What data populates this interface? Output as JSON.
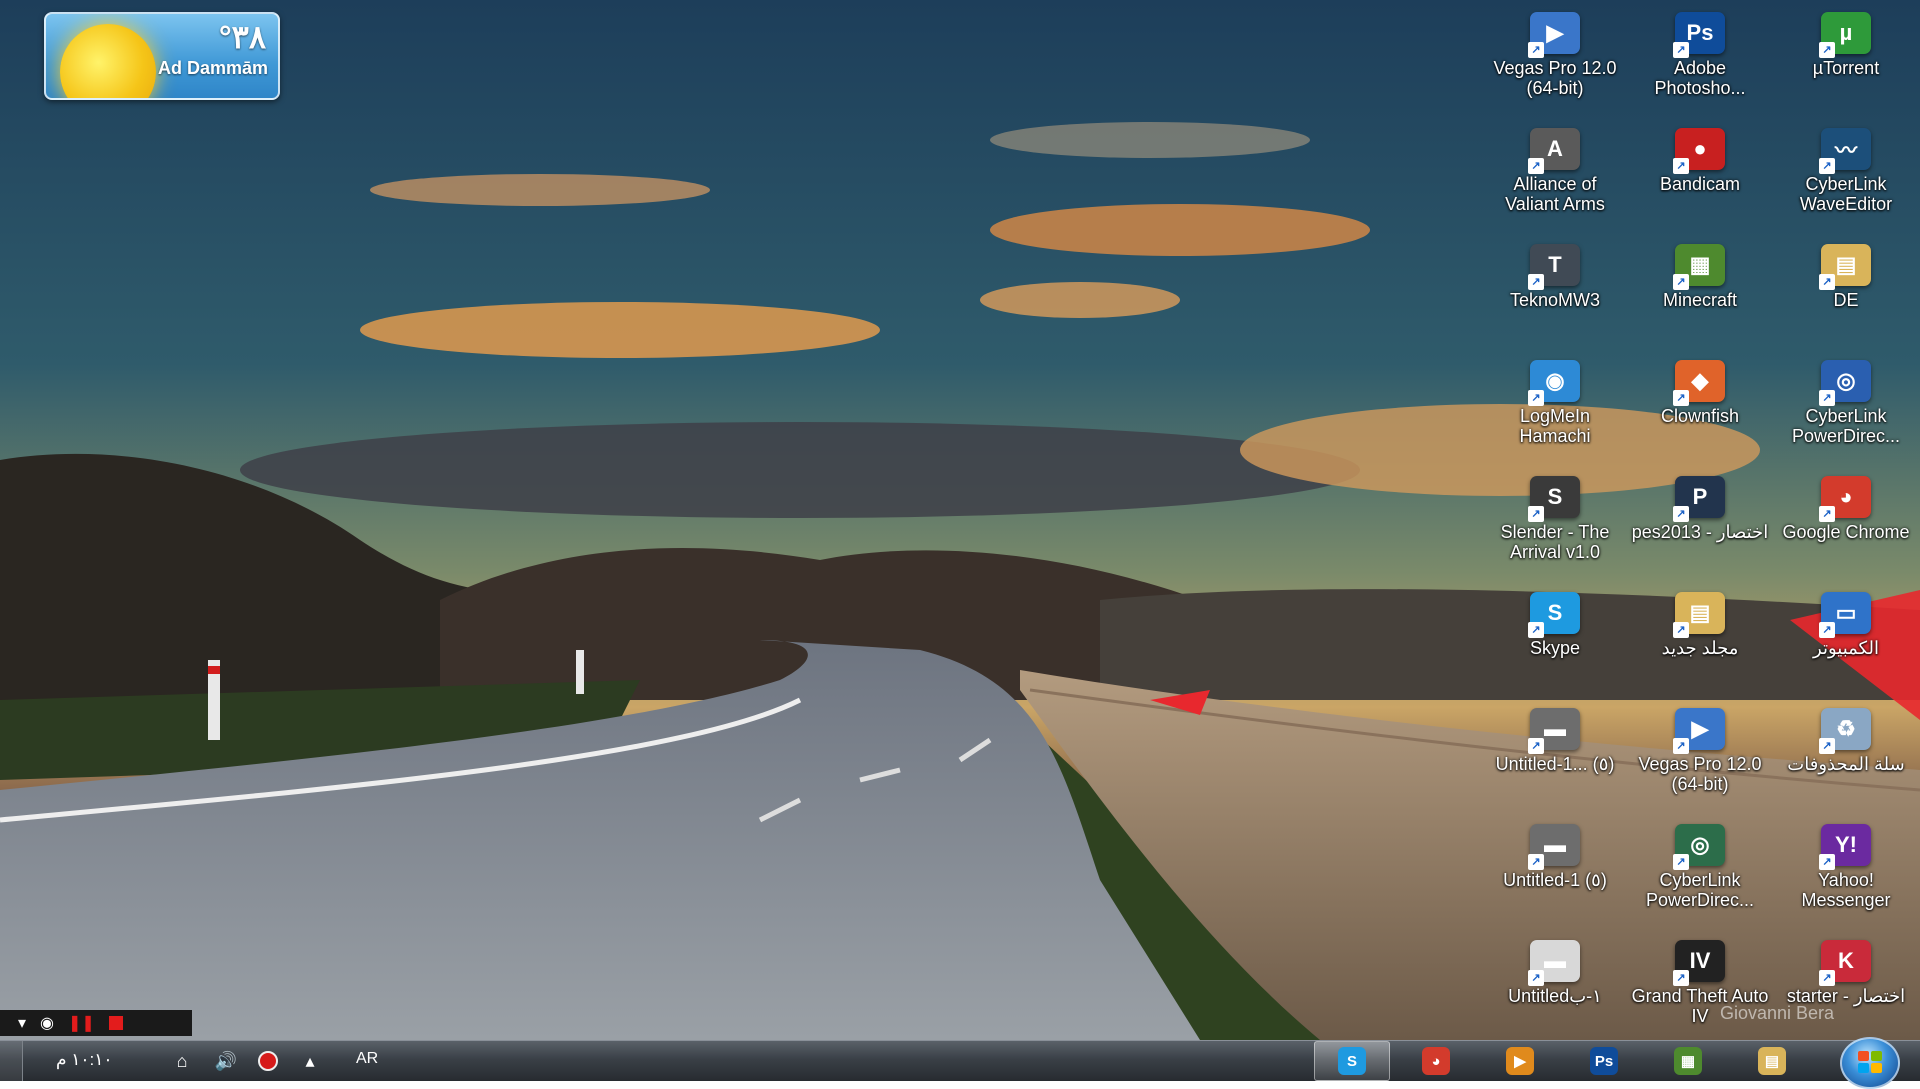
{
  "weather": {
    "temperature": "°٣٨",
    "city": "Ad Dammām"
  },
  "icons": [
    {
      "label": "Vegas Pro 12.0 (64-bit)",
      "icon": "vegas-icon",
      "color": "#3a76c9",
      "symbol": "▶"
    },
    {
      "label": "Adobe Photosho...",
      "icon": "photoshop-icon",
      "color": "#0f4c9a",
      "symbol": "Ps"
    },
    {
      "label": "µTorrent",
      "icon": "utorrent-icon",
      "color": "#2e9a3a",
      "symbol": "µ"
    },
    {
      "label": "Alliance of Valiant Arms",
      "icon": "ava-icon",
      "color": "#5a5a5a",
      "symbol": "A"
    },
    {
      "label": "Bandicam",
      "icon": "bandicam-icon",
      "color": "#c82020",
      "symbol": "●"
    },
    {
      "label": "CyberLink WaveEditor",
      "icon": "waveeditor-icon",
      "color": "#1c4f7a",
      "symbol": "〰"
    },
    {
      "label": "TeknoMW3",
      "icon": "teknomw3-icon",
      "color": "#404a55",
      "symbol": "T"
    },
    {
      "label": "Minecraft",
      "icon": "minecraft-icon",
      "color": "#4e8a2e",
      "symbol": "▦"
    },
    {
      "label": "DE",
      "icon": "folder-icon",
      "color": "#d9b45a",
      "symbol": "▤"
    },
    {
      "label": "LogMeIn Hamachi",
      "icon": "hamachi-icon",
      "color": "#2d8ad6",
      "symbol": "◉"
    },
    {
      "label": "Clownfish",
      "icon": "clownfish-icon",
      "color": "#e0632a",
      "symbol": "◆"
    },
    {
      "label": "CyberLink PowerDirec...",
      "icon": "powerdirector-icon",
      "color": "#2a5fb0",
      "symbol": "◎"
    },
    {
      "label": "Slender - The Arrival v1.0",
      "icon": "slender-icon",
      "color": "#3a3a3a",
      "symbol": "S"
    },
    {
      "label": "pes2013 - اختصار",
      "icon": "pes2013-icon",
      "color": "#22344d",
      "symbol": "P"
    },
    {
      "label": "Google Chrome",
      "icon": "chrome-icon",
      "color": "#d33b2c",
      "symbol": "◕"
    },
    {
      "label": "Skype",
      "icon": "skype-icon",
      "color": "#1e9ae0",
      "symbol": "S"
    },
    {
      "label": "مجلد جديد",
      "icon": "new-folder-icon",
      "color": "#d9b45a",
      "symbol": "▤"
    },
    {
      "label": "الكمبيوتر",
      "icon": "computer-icon",
      "color": "#2f73c9",
      "symbol": "▭"
    },
    {
      "label": "Untitled-1... (٥)",
      "icon": "untitled-file-icon",
      "color": "#6d6d6d",
      "symbol": "▬"
    },
    {
      "label": "Vegas Pro 12.0 (64-bit)",
      "icon": "vegas-icon",
      "color": "#3a76c9",
      "symbol": "▶"
    },
    {
      "label": "سلة المحذوفات",
      "icon": "recycle-bin-icon",
      "color": "#8aa7c4",
      "symbol": "♻"
    },
    {
      "label": "Untitled-1 (٥)",
      "icon": "untitled-file-icon",
      "color": "#6d6d6d",
      "symbol": "▬"
    },
    {
      "label": "CyberLink PowerDirec...",
      "icon": "powerdirector-icon",
      "color": "#2c6d4a",
      "symbol": "◎"
    },
    {
      "label": "Yahoo! Messenger",
      "icon": "yahoo-messenger-icon",
      "color": "#6b2aa0",
      "symbol": "Y!"
    },
    {
      "label": "Untitled١-ب",
      "icon": "untitled-file-icon",
      "color": "#d8d8d8",
      "symbol": "▬"
    },
    {
      "label": "Grand Theft Auto IV",
      "icon": "gta4-icon",
      "color": "#222",
      "symbol": "IV"
    },
    {
      "label": "starter - اختصار",
      "icon": "starter-icon",
      "color": "#c92a3a",
      "symbol": "K"
    }
  ],
  "recorder": {
    "down_icon": "▾",
    "camera_icon": "◉",
    "pause_icon": "❚❚"
  },
  "taskbar": {
    "clock": "١٠:١٠ م",
    "language": "AR",
    "tray": [
      {
        "name": "network-icon",
        "symbol": "⌂"
      },
      {
        "name": "volume-icon",
        "symbol": "🔊"
      },
      {
        "name": "show-hidden-icon",
        "symbol": "▴"
      }
    ],
    "apps": [
      {
        "name": "skype",
        "symbol": "S",
        "color": "#1e9ae0",
        "active": true
      },
      {
        "name": "chrome",
        "symbol": "◕",
        "color": "#d33b2c",
        "active": false
      },
      {
        "name": "media-player",
        "symbol": "▶",
        "color": "#e08a1c",
        "active": false
      },
      {
        "name": "photoshop",
        "symbol": "Ps",
        "color": "#0f4c9a",
        "active": false
      },
      {
        "name": "minecraft",
        "symbol": "▦",
        "color": "#4e8a2e",
        "active": false
      },
      {
        "name": "explorer",
        "symbol": "▤",
        "color": "#d9b45a",
        "active": false
      }
    ]
  },
  "watermark": "Giovanni Bera"
}
